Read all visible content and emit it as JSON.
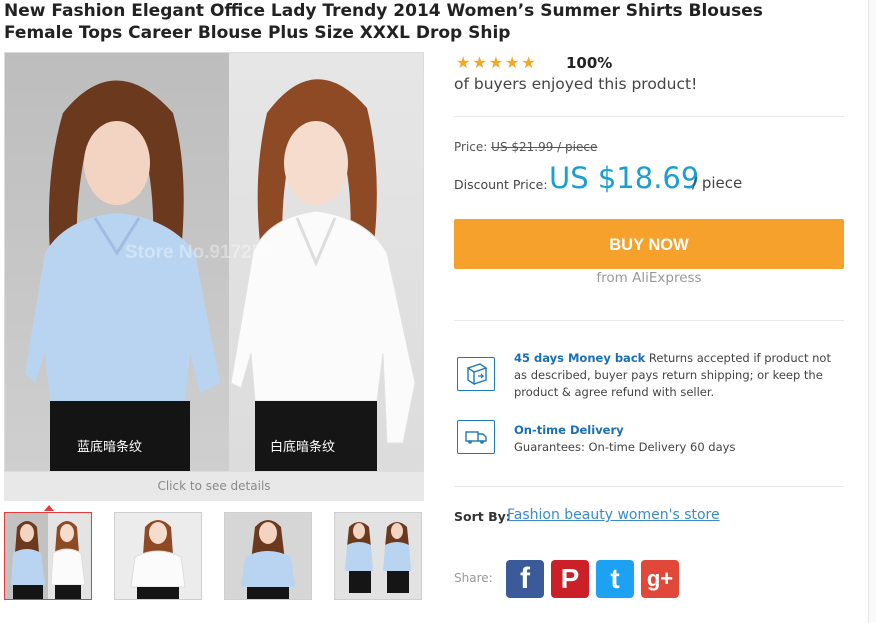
{
  "product": {
    "title_line1": "New Fashion Elegant Office Lady Trendy 2014 Women’s Summer Shirts Blouses",
    "title_line2": "Female Tops Career Blouse Plus Size XXXL Drop Ship"
  },
  "gallery": {
    "watermark": "Store No.917254",
    "caption_left": "蓝底暗条纹",
    "caption_right": "白底暗条纹",
    "click_hint": "Click to see details",
    "thumbnails": [
      {
        "icon": "blue-white-shirts-thumbnail",
        "selected": true
      },
      {
        "icon": "white-shirt-front-thumbnail",
        "selected": false
      },
      {
        "icon": "blue-shirt-pose-thumbnail",
        "selected": false
      },
      {
        "icon": "blue-shirt-skirt-thumbnail",
        "selected": false
      }
    ]
  },
  "rating": {
    "stars": "★★★★★",
    "stars_value": 5,
    "percent": "100%",
    "text": "of buyers enjoyed this product!"
  },
  "pricing": {
    "price_label": "Price:",
    "original_price": "US $21.99 / piece",
    "discount_label": "Discount Price:",
    "discount_price": "US $18.69",
    "unit": "/ piece"
  },
  "cta": {
    "buy_label": "BUY NOW",
    "from_label": "from AliExpress",
    "color": "#f7a12d"
  },
  "features": [
    {
      "icon": "return-box-icon",
      "title": "45 days Money back",
      "text": " Returns accepted if product not as described, buyer pays return shipping; or keep the product & agree refund with seller."
    },
    {
      "icon": "delivery-truck-icon",
      "title": "On-time Delivery",
      "text": "Guarantees: On-time Delivery 60 days"
    }
  ],
  "store": {
    "sort_label": "Sort By:",
    "name": "Fashion beauty women's store"
  },
  "share": {
    "label": "Share:",
    "networks": [
      {
        "icon": "facebook-icon",
        "glyph": "f",
        "color": "#3b5a9a"
      },
      {
        "icon": "pinterest-icon",
        "glyph": "P",
        "color": "#cb2027"
      },
      {
        "icon": "twitter-icon",
        "glyph": "t",
        "color": "#1da1f2"
      },
      {
        "icon": "google-plus-icon",
        "glyph": "g+",
        "color": "#e0483a"
      }
    ]
  },
  "colors": {
    "accent_blue": "#1a9fd4",
    "link_blue": "#3a8bc8"
  }
}
